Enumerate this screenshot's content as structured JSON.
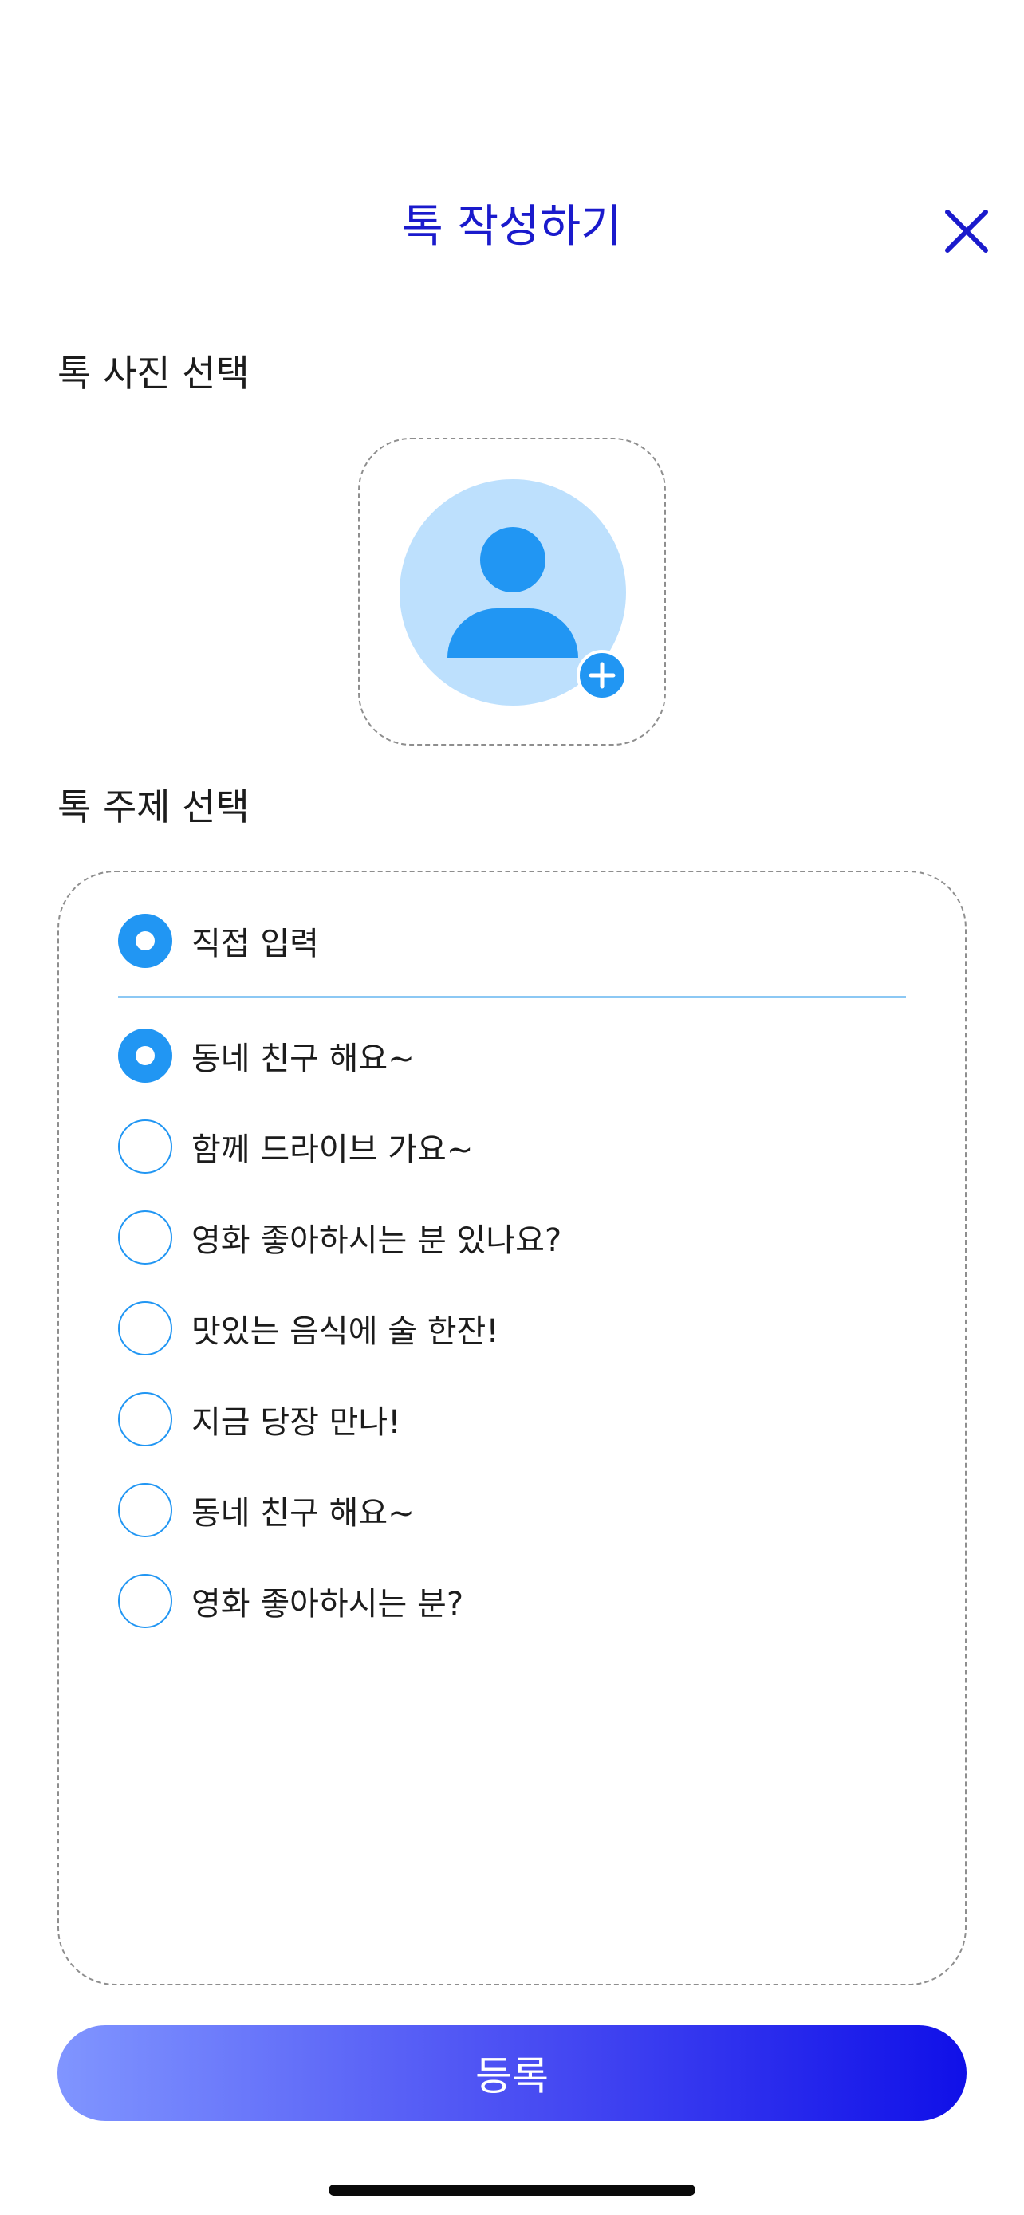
{
  "header": {
    "title": "톡 작성하기",
    "close_icon": "close-icon"
  },
  "photo_section": {
    "label": "톡 사진 선택",
    "avatar_icon": "user-avatar-icon",
    "add_icon": "plus-icon"
  },
  "topic_section": {
    "label": "톡 주제 선택",
    "custom_option": {
      "label": "직접 입력",
      "checked": true
    },
    "options": [
      {
        "label": "동네 친구 해요~",
        "checked": true
      },
      {
        "label": "함께 드라이브 가요~",
        "checked": false
      },
      {
        "label": "영화 좋아하시는 분 있나요?",
        "checked": false
      },
      {
        "label": "맛있는 음식에 술 한잔!",
        "checked": false
      },
      {
        "label": "지금 당장 만나!",
        "checked": false
      },
      {
        "label": "동네 친구 해요~",
        "checked": false
      },
      {
        "label": "영화 좋아하시는 분?",
        "checked": false
      }
    ]
  },
  "submit_button": {
    "label": "등록"
  },
  "colors": {
    "accent": "#2196f3",
    "title": "#1a1acc",
    "gradient_start": "#8095ff",
    "gradient_end": "#1010e8"
  }
}
